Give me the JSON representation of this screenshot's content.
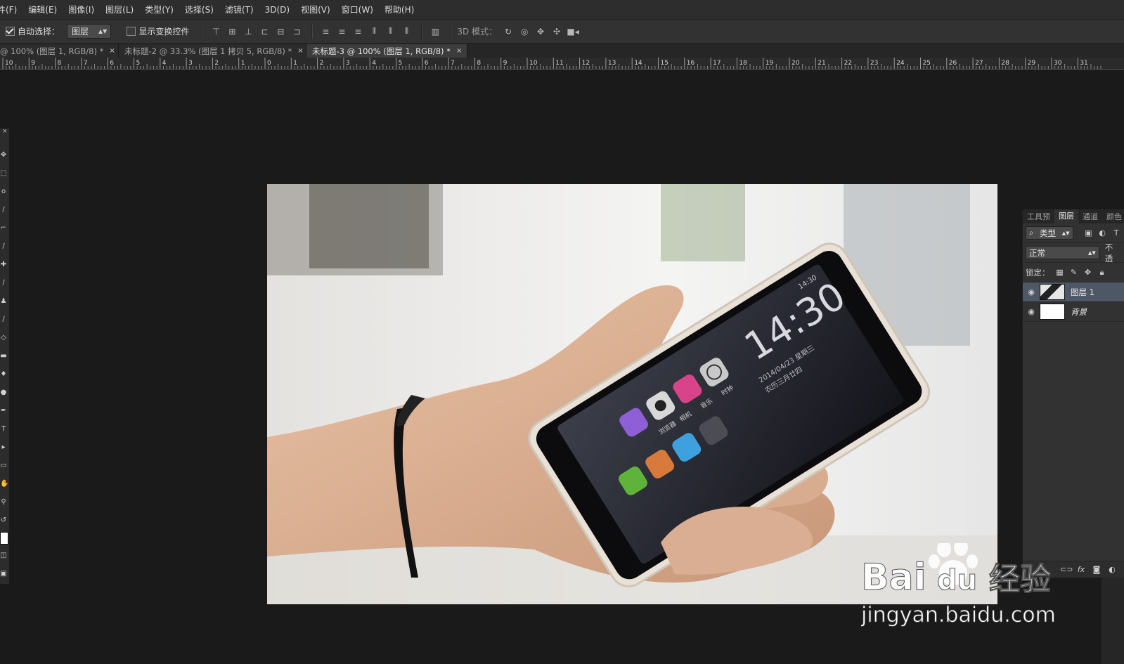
{
  "menu": [
    "件(F)",
    "编辑(E)",
    "图像(I)",
    "图层(L)",
    "类型(Y)",
    "选择(S)",
    "滤镜(T)",
    "3D(D)",
    "视图(V)",
    "窗口(W)",
    "帮助(H)"
  ],
  "options": {
    "auto_select_label": "自动选择：",
    "auto_select_value": "图层",
    "show_transform_label": "显示变换控件",
    "mode_3d_label": "3D 模式："
  },
  "tabs": [
    {
      "label": "@ 100% (图层 1, RGB/8) *",
      "close": "×"
    },
    {
      "label": "未标题-2 @ 33.3% (图层 1 拷贝 5, RGB/8) *",
      "close": "×"
    },
    {
      "label": "未标题-3 @ 100% (图层 1, RGB/8) *",
      "close": "×"
    }
  ],
  "ruler_labels": [
    "10",
    "9",
    "8",
    "7",
    "6",
    "5",
    "4",
    "3",
    "2",
    "1",
    "0",
    "1",
    "2",
    "3",
    "4",
    "5",
    "6",
    "7",
    "8",
    "9",
    "10",
    "11",
    "12",
    "13",
    "14",
    "15",
    "16",
    "17",
    "18",
    "19",
    "20",
    "21",
    "22",
    "23",
    "24",
    "25",
    "26",
    "27",
    "28",
    "29",
    "30",
    "31"
  ],
  "phone": {
    "time": "14:30",
    "date": "2014/04/23 星期三",
    "lunar": "农历三月廿四",
    "status_time": "14:30",
    "app_labels": [
      "浏览器",
      "相机",
      "音乐",
      "时钟"
    ]
  },
  "layers_panel": {
    "tabs": [
      "工具预",
      "图层",
      "通道",
      "颜色",
      "色"
    ],
    "filter_label": "类型",
    "blend_mode": "正常",
    "opacity_label": "不透",
    "lock_label": "锁定：",
    "layers": [
      {
        "name": "图层 1",
        "selected": true
      },
      {
        "name": "背景",
        "selected": false
      }
    ]
  },
  "watermark": {
    "brand": "Bai",
    "brand_du": "du",
    "suffix": "经验",
    "url": "jingyan.baidu.com"
  },
  "colors": {
    "menubar": "#2d2d2d",
    "workspace": "#1a1a1a",
    "panel": "#323232",
    "selected_layer": "#4d5766"
  }
}
